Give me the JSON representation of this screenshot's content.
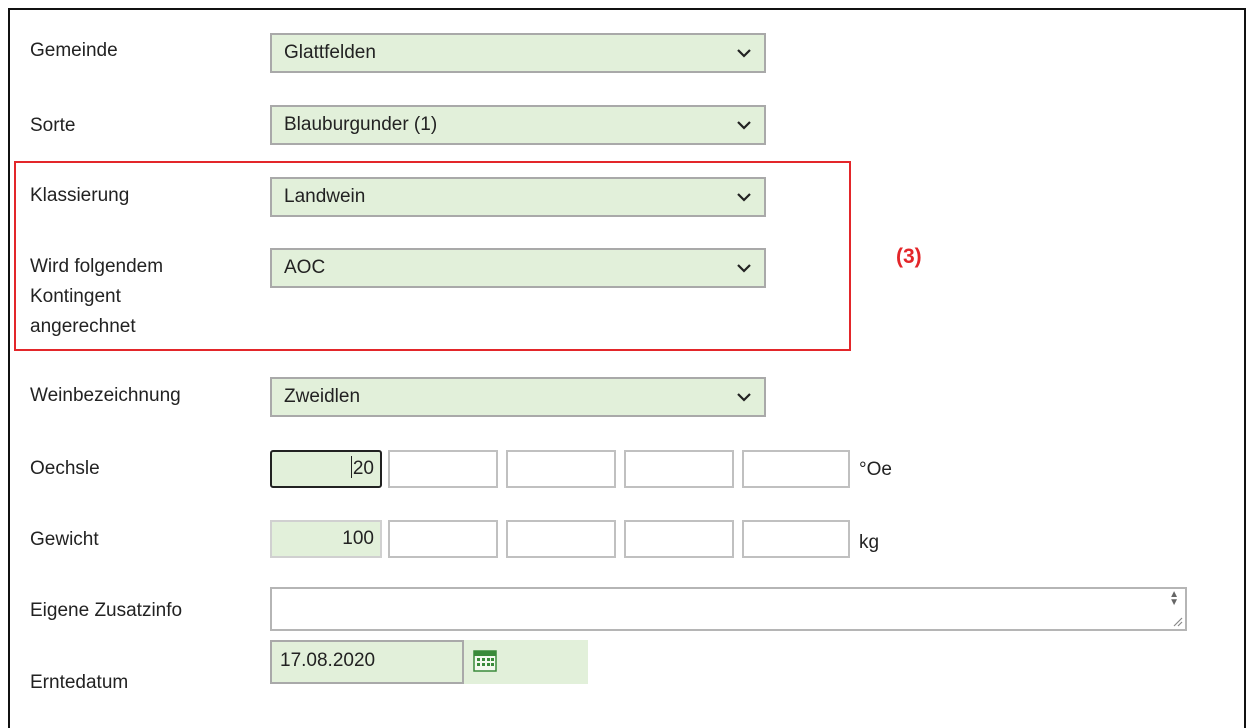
{
  "form": {
    "gemeinde": {
      "label": "Gemeinde",
      "value": "Glattfelden"
    },
    "sorte": {
      "label": "Sorte",
      "value": "Blauburgunder (1)"
    },
    "klassierung": {
      "label": "Klassierung",
      "value": "Landwein"
    },
    "kontingent": {
      "label_line1": "Wird folgendem",
      "label_line2": "Kontingent",
      "label_line3": "angerechnet",
      "value": "AOC"
    },
    "weinbezeichnung": {
      "label": "Weinbezeichnung",
      "value": "Zweidlen"
    },
    "oechsle": {
      "label": "Oechsle",
      "values": [
        "20",
        "",
        "",
        "",
        ""
      ],
      "unit": "°Oe"
    },
    "gewicht": {
      "label": "Gewicht",
      "values": [
        "100",
        "",
        "",
        "",
        ""
      ],
      "unit": "kg"
    },
    "zusatzinfo": {
      "label": "Eigene Zusatzinfo",
      "value": ""
    },
    "erntedatum": {
      "label": "Erntedatum",
      "value": "17.08.2020"
    }
  },
  "annotation": {
    "text": "(3)"
  },
  "colors": {
    "field_bg": "#e2f0da",
    "highlight": "#e3262a",
    "border": "#a9a9a9"
  },
  "icons": {
    "dropdown": "chevron-down-icon",
    "calendar": "calendar-icon",
    "resize": "resize-grip-icon"
  }
}
